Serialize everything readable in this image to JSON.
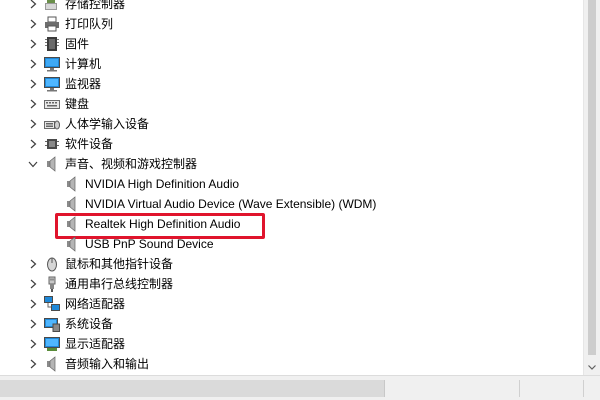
{
  "tree": {
    "categories": [
      {
        "label": "存储控制器",
        "icon": "storage-controller-icon",
        "expanded": false
      },
      {
        "label": "打印队列",
        "icon": "print-queue-icon",
        "expanded": false
      },
      {
        "label": "固件",
        "icon": "firmware-icon",
        "expanded": false
      },
      {
        "label": "计算机",
        "icon": "computer-icon",
        "expanded": false
      },
      {
        "label": "监视器",
        "icon": "monitor-icon",
        "expanded": false
      },
      {
        "label": "键盘",
        "icon": "keyboard-icon",
        "expanded": false
      },
      {
        "label": "人体学输入设备",
        "icon": "hid-icon",
        "expanded": false
      },
      {
        "label": "软件设备",
        "icon": "software-device-icon",
        "expanded": false
      },
      {
        "label": "声音、视频和游戏控制器",
        "icon": "speaker-icon",
        "expanded": true,
        "children": [
          {
            "label": "NVIDIA High Definition Audio",
            "icon": "speaker-icon"
          },
          {
            "label": "NVIDIA Virtual Audio Device (Wave Extensible) (WDM)",
            "icon": "speaker-icon"
          },
          {
            "label": "Realtek High Definition Audio",
            "icon": "speaker-icon",
            "highlighted": true
          },
          {
            "label": "USB PnP Sound Device",
            "icon": "speaker-icon"
          }
        ]
      },
      {
        "label": "鼠标和其他指针设备",
        "icon": "mouse-icon",
        "expanded": false
      },
      {
        "label": "通用串行总线控制器",
        "icon": "usb-icon",
        "expanded": false
      },
      {
        "label": "网络适配器",
        "icon": "network-adapter-icon",
        "expanded": false
      },
      {
        "label": "系统设备",
        "icon": "system-device-icon",
        "expanded": false
      },
      {
        "label": "显示适配器",
        "icon": "display-adapter-icon",
        "expanded": false
      },
      {
        "label": "音频输入和输出",
        "icon": "speaker-icon",
        "expanded": false
      }
    ]
  },
  "colors": {
    "highlight_border": "#e0142c",
    "chevron": "#404040"
  }
}
